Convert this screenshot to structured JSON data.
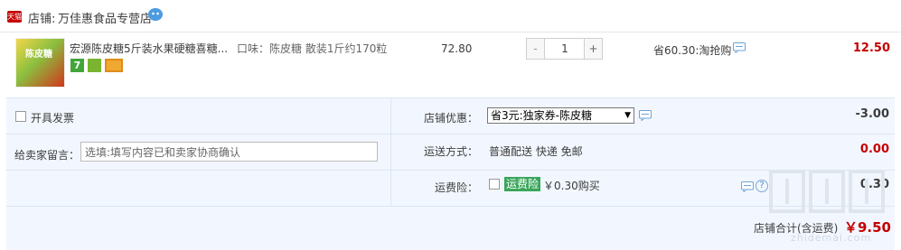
{
  "shop": {
    "badge": "天猫",
    "label": "店铺:",
    "name": "万佳惠食品专营店"
  },
  "item": {
    "title": "宏源陈皮糖5斤装水果硬糖喜糖...",
    "sku": "口味：陈皮糖 散装1斤约170粒",
    "image_text": "陈皮糖",
    "service_icons": [
      "seven-day-return-icon",
      "shield-icon",
      "card-icon"
    ],
    "service_7": "7",
    "unit_price": "72.80",
    "quantity": "1",
    "qty_minus": "-",
    "qty_plus": "+",
    "promo": "省60.30:淘抢购",
    "subtotal": "12.50"
  },
  "order": {
    "invoice_label": "开具发票",
    "message_label": "给卖家留言：",
    "message_placeholder": "选填:填写内容已和卖家协商确认",
    "coupon_label": "店铺优惠：",
    "coupon_selected": "省3元:独家券-陈皮糖",
    "coupon_arrow": "▼",
    "discount": "-3.00",
    "shipping_label": "运送方式：",
    "shipping_value": "普通配送 快递 免邮",
    "shipping_fee": "0.00",
    "insurance_label": "运费险：",
    "insurance_tag": "运费险",
    "insurance_price": "￥0.30购买",
    "insurance_help": "?",
    "insurance_value": "0.30",
    "total_label": "店铺合计(含运费)",
    "total_value": "￥9.50"
  },
  "watermark": "zhidemai.com",
  "colors": {
    "price_red": "#c40000",
    "panel_bg": "#f2f7ff",
    "insurance_green": "#3aa65b",
    "tmall_red": "#c40000"
  }
}
